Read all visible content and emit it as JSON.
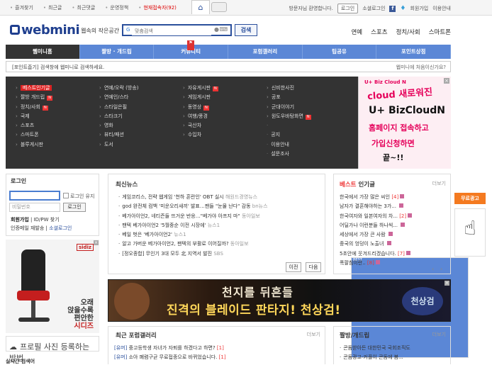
{
  "topbar": {
    "links": [
      "즐겨찾기",
      "최근글",
      "최근댓글",
      "운영정책",
      "현재접속자(92)"
    ],
    "welcome": "방문자님 환영합니다.",
    "login": "로그인",
    "social_login": "소셜로그인",
    "join": "회원가입",
    "guide": "이용안내"
  },
  "header": {
    "logo": "webmini",
    "slogan": "웹속의 작은공간",
    "search_placeholder": "맞춤검색",
    "search_button": "검색",
    "nav": [
      "연예",
      "스포츠",
      "정치/사회",
      "스마트폰"
    ]
  },
  "menu": [
    "웹미니홈",
    "짤방 · 개드립",
    "커뮤니티",
    "포럼갤러리",
    "팁공유",
    "포인트상점"
  ],
  "notice": {
    "left": "[포인트줍기] 검색창에 웹미니로 검색하세요.",
    "right": "웹미니에 처음이신가요?"
  },
  "categories": {
    "col1": [
      "베스트인기글",
      "짤방 개드립",
      "정치/사회",
      "국제",
      "스포츠",
      "스마트폰",
      "블루게시판"
    ],
    "col2": [
      "연예/오락 (방송)",
      "연예인/스타",
      "스타일은필",
      "스타크기",
      "영화",
      "뷰티/패션",
      "도서"
    ],
    "col3": [
      "자유게시판",
      "게임게시판",
      "동영상",
      "여행/풍경",
      "국산차",
      "수입차"
    ],
    "col4": [
      "신비한사진",
      "공포",
      "군대이야기",
      "원도우바탕화면",
      "",
      "공지",
      "이용안내",
      "설문조사"
    ],
    "best_badge": "BEST",
    "new_badge": "N"
  },
  "ad_right": {
    "brand": "U+ Biz Cloud N",
    "line1": "cloud 새로워진",
    "line2": "U+ BizCloudN",
    "line3": "홈페이지 접속하고",
    "line4": "가입신청하면",
    "line5": "끝~!!"
  },
  "login_box": {
    "title": "로그인",
    "keep": "로그인 유지",
    "password_placeholder": "비밀번호",
    "login_button": "로그인",
    "join": "회원가입",
    "find": "ID/PW 찾기",
    "verify": "인증메일 재발송",
    "social": "소셜로그인"
  },
  "ad_left": {
    "brand": "sidiz",
    "text1": "오래",
    "text2": "앉을수록",
    "text3": "편안한",
    "text4": "시디즈"
  },
  "upload": "프로필 사진 등록하는 방법",
  "bottom_left": "실시간 검색어",
  "news": {
    "title": "최신뉴스",
    "items": [
      {
        "text": "게임코리스, 전략 웹게임 '천하 혼란인' OBT 실시",
        "src": "해원드경영뉴스"
      },
      {
        "text": "god 완전체 컴백 '미운오리새끼' 발표…팬들 \"눈물 난다\" 감동",
        "src": "bn뉴스"
      },
      {
        "text": "베가아이언2, 네티즌들 뜨거운 반응…\"베가야 아프지 마\"",
        "src": "동아일보"
      },
      {
        "text": "팬텍 베가아이언2 '5월중순 이전 시장에'",
        "src": "뉴스1"
      },
      {
        "text": "베일 벗은 '베가아이언2'",
        "src": "뉴스1"
      },
      {
        "text": "알고 가버운 베가아이언2, 팬텍의 부활로 이어질까?",
        "src": "동아일보"
      },
      {
        "text": "[정오종합] 무인기 3대 모두 北 지역서 발진",
        "src": "SBS"
      }
    ],
    "prev": "이전",
    "next": "다음"
  },
  "best": {
    "title_red": "베스트",
    "title_black": "인기글",
    "more": "더보기",
    "items": [
      {
        "text": "한국에서 가장 많은 씨인",
        "count": "[4]"
      },
      {
        "text": "남자가 결혼해야하는 3가...",
        "count": ""
      },
      {
        "text": "한국여자와 일본여자의 차...",
        "count": "[2]"
      },
      {
        "text": "어딜가나 이런분들 하나씩...",
        "count": ""
      },
      {
        "text": "세상에서 가장 큰 사람",
        "count": ""
      },
      {
        "text": "중국의 엉덩이 노출녀",
        "count": ""
      },
      {
        "text": "5초안에 웃겨드리겠습니다.",
        "count": "[7]"
      },
      {
        "text": "폭팔침이란..",
        "count": "[8]"
      }
    ]
  },
  "banner": {
    "line1": "천지를 뒤흔들",
    "line2": "진격의 블레이드 판타지! 천상검!",
    "logo": "천상검"
  },
  "gallery": {
    "title": "최근 포럼갤러리",
    "more": "더보기",
    "items": [
      {
        "tag": "[유머]",
        "text": "중고등학생 자녀가 자퇴를 하겠다고 하면?",
        "count": "[1]"
      },
      {
        "tag": "[유머]",
        "text": "소아 폐렴구균 무료접종으로 바뀌었습니다.",
        "count": "[1]"
      }
    ]
  },
  "humor": {
    "title": "짤방/개드립",
    "more": "더보기",
    "items": [
      "콘돔받아든 대한민국 국회조직도",
      "콘돔광고-커플이 콘돔에 봄..."
    ]
  },
  "side": {
    "free_ad": "무료광고"
  },
  "colors": {
    "menu_blue": "#5b87d6",
    "brand_blue": "#1f3f8f",
    "accent_red": "#e33"
  }
}
